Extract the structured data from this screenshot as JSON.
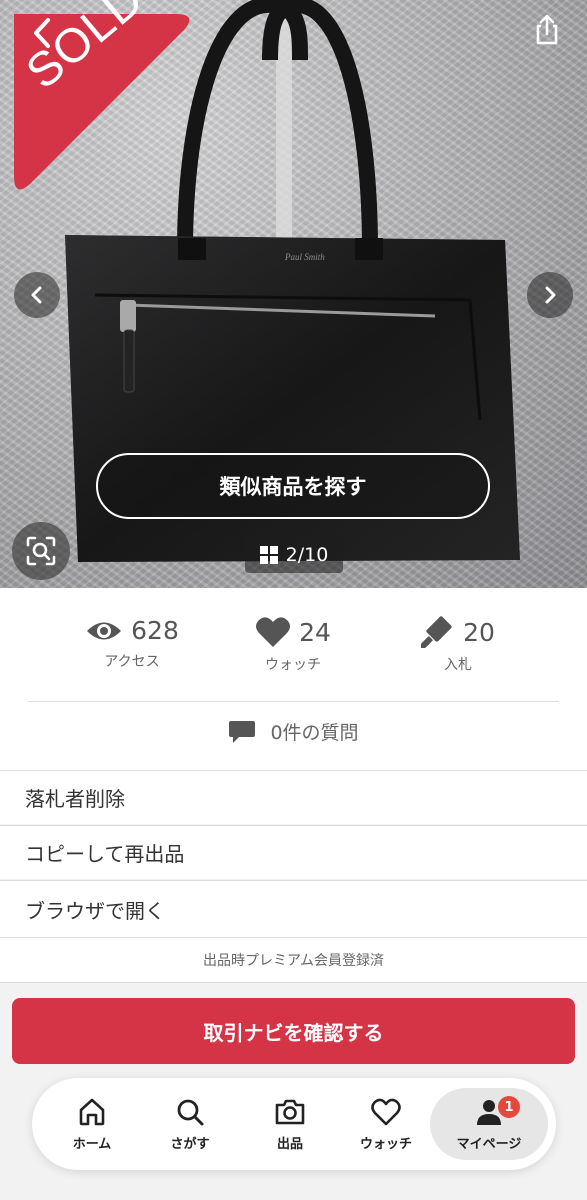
{
  "hero": {
    "sold_label": "SOLD",
    "similar_button": "類似商品を探す",
    "page_indicator": "2/10",
    "bag_logo_text": "Paul Smith"
  },
  "stats": {
    "access": {
      "value": "628",
      "label": "アクセス",
      "icon": "eye-icon"
    },
    "watch": {
      "value": "24",
      "label": "ウォッチ",
      "icon": "heart-icon"
    },
    "bids": {
      "value": "20",
      "label": "入札",
      "icon": "gavel-icon"
    }
  },
  "questions": {
    "label": "0件の質問",
    "icon": "speech-bubble-icon"
  },
  "menu": [
    {
      "label": "落札者削除"
    },
    {
      "label": "コピーして再出品"
    },
    {
      "label": "ブラウザで開く"
    }
  ],
  "premium_note": "出品時プレミアム会員登録済",
  "cta_button": "取引ナビを確認する",
  "tabbar": {
    "items": [
      {
        "label": "ホーム",
        "icon": "home-icon"
      },
      {
        "label": "さがす",
        "icon": "search-icon"
      },
      {
        "label": "出品",
        "icon": "camera-icon"
      },
      {
        "label": "ウォッチ",
        "icon": "heart-outline-icon"
      },
      {
        "label": "マイページ",
        "icon": "person-icon",
        "badge": "1"
      }
    ]
  },
  "colors": {
    "accent": "#d53446",
    "badge": "#e5473d",
    "sold": "#d53446"
  }
}
